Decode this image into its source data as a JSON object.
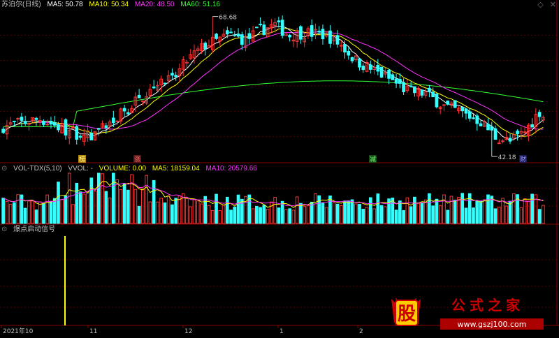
{
  "title_bar": {
    "stock_name": "苏泊尔(日线)",
    "ma_items": [
      {
        "label": "MA5: 50.78",
        "color": "#ffffff"
      },
      {
        "label": "MA10: 50.34",
        "color": "#ffff00"
      },
      {
        "label": "MA20: 48.50",
        "color": "#ff33ff"
      },
      {
        "label": "MA60: 51.16",
        "color": "#33ff33"
      }
    ]
  },
  "vol_bar": {
    "items": [
      {
        "label": "VOL-TDX(5,10)",
        "color": "#c0c0c0"
      },
      {
        "label": "VVOL: -",
        "color": "#c0c0c0"
      },
      {
        "label": "VOLUME: 0.00",
        "color": "#ffff00"
      },
      {
        "label": "MA5: 18159.04",
        "color": "#ffff00"
      },
      {
        "label": "MA10: 20579.66",
        "color": "#ff33ff"
      }
    ]
  },
  "signal_bar": {
    "label": "爆点启动信号"
  },
  "x_axis": {
    "labels": [
      "2021年10",
      "11",
      "12",
      "1",
      "2"
    ]
  },
  "annotations": {
    "high_label": "68.68",
    "low_label": "42.18"
  },
  "markers": [
    "榜",
    "涨",
    "减",
    "财"
  ],
  "watermark": {
    "logo": "股",
    "title": "公式之家",
    "url": "www.gszj100.com"
  },
  "colors": {
    "up": "#ff3333",
    "down": "#33ffff",
    "ma5": "#ffffff",
    "ma10": "#ffff00",
    "ma20": "#ff33ff",
    "ma60": "#33ff33",
    "signal": "#ffff00"
  },
  "chart_data": [
    {
      "type": "candlestick",
      "ylim": [
        40,
        70
      ],
      "price_high": 68.68,
      "price_low": 42.18,
      "ma": {
        "MA5": 50.78,
        "MA10": 50.34,
        "MA20": 48.5,
        "MA60": 51.16
      }
    },
    {
      "type": "bar",
      "series": [
        {
          "name": "VOLUME",
          "values": []
        }
      ],
      "ma": {
        "MA5": 18159.04,
        "MA10": 20579.66
      }
    },
    {
      "type": "bar",
      "series": [
        {
          "name": "爆点启动信号",
          "values": [
            1
          ]
        }
      ]
    }
  ]
}
